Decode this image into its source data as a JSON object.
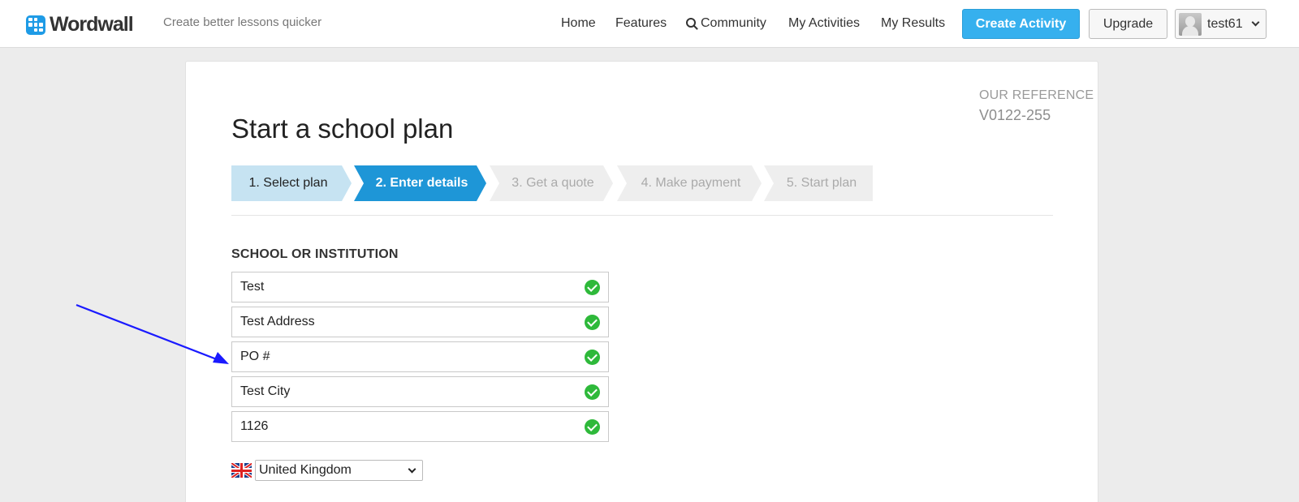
{
  "brand": {
    "name": "Wordwall",
    "tagline": "Create better lessons quicker"
  },
  "nav": {
    "home": "Home",
    "features": "Features",
    "community": "Community",
    "my_activities": "My Activities",
    "my_results": "My Results"
  },
  "actions": {
    "create_activity": "Create Activity",
    "upgrade": "Upgrade"
  },
  "user": {
    "name": "test61"
  },
  "reference": {
    "label": "OUR REFERENCE",
    "value": "V0122-255"
  },
  "page": {
    "title": "Start a school plan"
  },
  "steps": [
    {
      "label": "1. Select plan",
      "state": "done"
    },
    {
      "label": "2. Enter details",
      "state": "active"
    },
    {
      "label": "3. Get a quote",
      "state": "pending"
    },
    {
      "label": "4. Make payment",
      "state": "pending"
    },
    {
      "label": "5. Start plan",
      "state": "pending"
    }
  ],
  "form": {
    "section_label": "SCHOOL OR INSTITUTION",
    "fields": [
      {
        "value": "Test",
        "valid": true
      },
      {
        "value": "Test Address",
        "valid": true
      },
      {
        "value": "PO #",
        "valid": true
      },
      {
        "value": "Test City",
        "valid": true
      },
      {
        "value": "1126",
        "valid": true
      }
    ],
    "country": {
      "selected": "United Kingdom",
      "flag": "uk-flag-icon"
    }
  },
  "colors": {
    "accent": "#36b0ee",
    "step_active": "#1e96d7",
    "step_done": "#c6e3f2",
    "valid": "#2eb93a",
    "annotation_arrow": "#1a1aff"
  }
}
